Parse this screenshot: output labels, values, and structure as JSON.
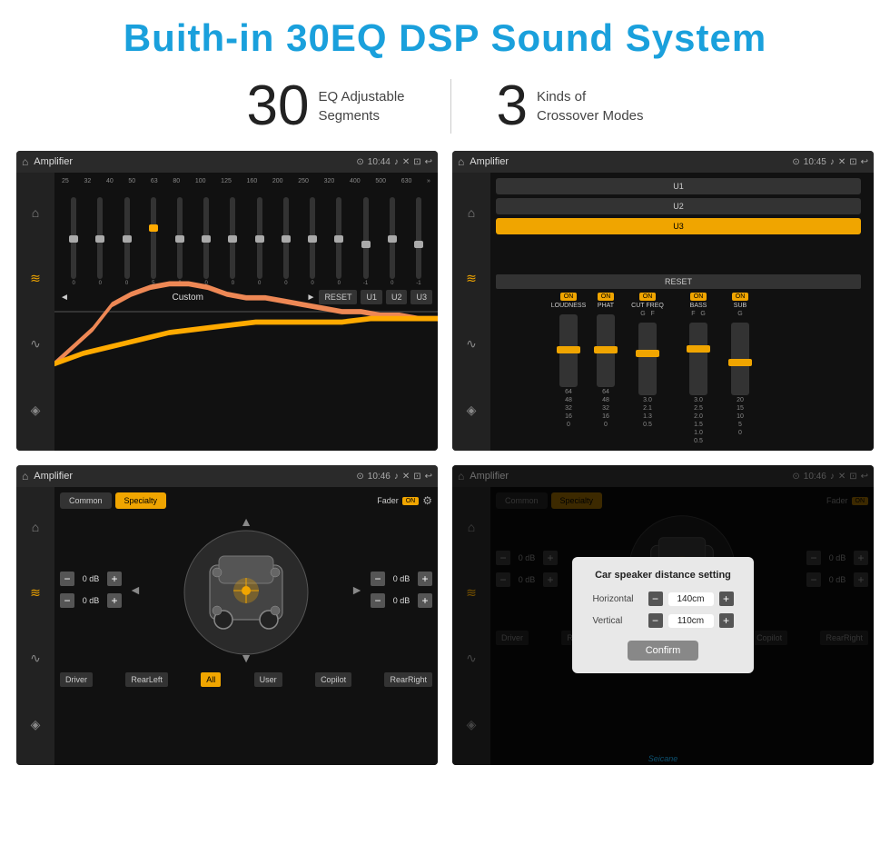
{
  "header": {
    "title": "Buith-in 30EQ DSP Sound System"
  },
  "stats": [
    {
      "number": "30",
      "text_line1": "EQ Adjustable",
      "text_line2": "Segments"
    },
    {
      "number": "3",
      "text_line1": "Kinds of",
      "text_line2": "Crossover Modes"
    }
  ],
  "screens": {
    "eq": {
      "topbar": {
        "title": "Amplifier",
        "time": "10:44"
      },
      "freq_labels": [
        "25",
        "32",
        "40",
        "50",
        "63",
        "80",
        "100",
        "125",
        "160",
        "200",
        "250",
        "320",
        "400",
        "500",
        "630"
      ],
      "slider_values": [
        "0",
        "0",
        "0",
        "5",
        "0",
        "0",
        "0",
        "0",
        "0",
        "0",
        "0",
        "-1",
        "0",
        "-1"
      ],
      "preset_label": "Custom",
      "buttons": [
        "RESET",
        "U1",
        "U2",
        "U3"
      ]
    },
    "crossover": {
      "topbar": {
        "title": "Amplifier",
        "time": "10:45"
      },
      "presets": [
        "U1",
        "U2",
        "U3"
      ],
      "active_preset": "U3",
      "channels": [
        {
          "label": "LOUDNESS",
          "on": true
        },
        {
          "label": "PHAT",
          "on": true
        },
        {
          "label": "CUT FREQ",
          "on": true
        },
        {
          "label": "BASS",
          "on": true
        },
        {
          "label": "SUB",
          "on": true
        }
      ],
      "reset_label": "RESET"
    },
    "speaker": {
      "topbar": {
        "title": "Amplifier",
        "time": "10:46"
      },
      "tabs": [
        "Common",
        "Specialty"
      ],
      "active_tab": "Specialty",
      "fader_label": "Fader",
      "fader_on": "ON",
      "zones": {
        "driver_label": "Driver",
        "copilot_label": "Copilot",
        "rear_left_label": "RearLeft",
        "all_label": "All",
        "user_label": "User",
        "rear_right_label": "RearRight"
      },
      "db_values": [
        "0 dB",
        "0 dB",
        "0 dB",
        "0 dB"
      ]
    },
    "speaker_dialog": {
      "topbar": {
        "title": "Amplifier",
        "time": "10:46"
      },
      "tabs": [
        "Common",
        "Specialty"
      ],
      "active_tab": "Specialty",
      "dialog": {
        "title": "Car speaker distance setting",
        "horizontal_label": "Horizontal",
        "horizontal_value": "140cm",
        "vertical_label": "Vertical",
        "vertical_value": "110cm",
        "confirm_label": "Confirm"
      },
      "zones": {
        "driver_label": "Driver",
        "copilot_label": "Copilot",
        "rear_left_label": "RearLeft",
        "rear_right_label": "RearRight"
      }
    }
  },
  "watermark": "Seicane"
}
